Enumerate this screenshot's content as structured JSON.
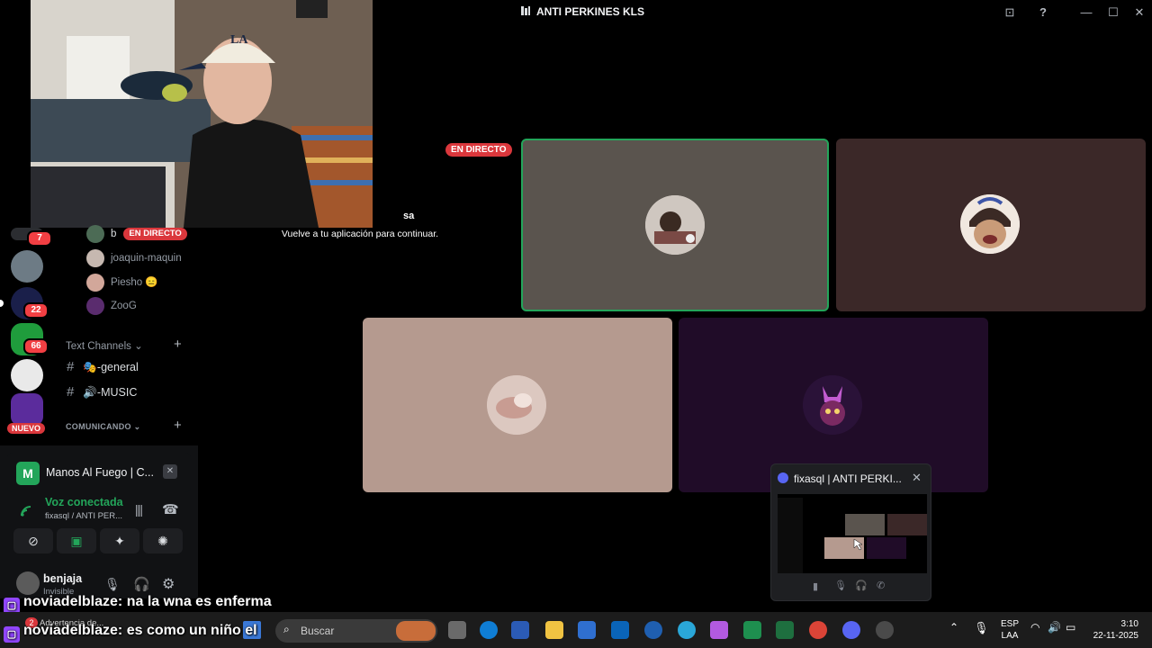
{
  "window": {
    "title": "ANTI PERKINES KLS",
    "buttons": {
      "inbox": "⊡",
      "help": "?",
      "minimize": "—",
      "maximize": "☐",
      "close": "✕"
    }
  },
  "server_badges": [
    "7",
    "22",
    "66"
  ],
  "server_new_label": "NUEVO",
  "voice_users": [
    {
      "name": "b",
      "live": "EN DIRECTO"
    },
    {
      "name": "joaquin-maquin"
    },
    {
      "name": "Piesho 😑"
    },
    {
      "name": "ZooG"
    }
  ],
  "text_channels": {
    "category": "Text Channels",
    "items": [
      {
        "emoji": "🎭",
        "name": "-general"
      },
      {
        "emoji": "🔊",
        "name": "-MUSIC"
      }
    ]
  },
  "comunicando": {
    "category": "COMUNICANDO"
  },
  "activity": {
    "icon": "M",
    "title": "Manos Al Fuego | C..."
  },
  "voice": {
    "status": "Voz conectada",
    "channel": "fixasql / ANTI PER..."
  },
  "user": {
    "name": "benjaja",
    "status": "Invisible"
  },
  "stage": {
    "live_tag": "EN DIRECTO",
    "overlay_name": "sa",
    "continue_note": "Vuelve a tu aplicación para continuar."
  },
  "popup": {
    "title": "fixasql | ANTI PERKI..."
  },
  "chat": [
    {
      "user": "noviadelblaze",
      "msg": ": na la wna es enferma"
    },
    {
      "user": "noviadelblaze",
      "msg": ": es como un niño el"
    }
  ],
  "taskbar": {
    "warning": "Advertencia de...",
    "search_placeholder": "Buscar",
    "lang_top": "ESP",
    "lang_bottom": "LAA",
    "time": "3:10",
    "date": "22-11-2025"
  },
  "colors": {
    "live": "#da373c",
    "voice_green": "#23a55a",
    "tile_1": "#5a544e",
    "tile_2": "#3b2828",
    "tile_3": "#b59a8f",
    "tile_4": "#200c28"
  }
}
